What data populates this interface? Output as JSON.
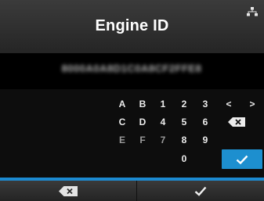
{
  "header": {
    "title": "Engine ID",
    "status_icon": "network-icon"
  },
  "value": {
    "display": "8000A0A8D1C0A8CF2FFE8"
  },
  "keypad": {
    "rows": [
      [
        "A",
        "B",
        "1",
        "2",
        "3",
        "<",
        ">"
      ],
      [
        "C",
        "D",
        "4",
        "5",
        "6"
      ],
      [
        "E",
        "F",
        "7",
        "8",
        "9"
      ],
      [
        "0"
      ]
    ],
    "backspace_icon": "backspace-icon",
    "enter_icon": "checkmark-icon"
  },
  "footer": {
    "left_icon": "backspace-icon",
    "right_icon": "checkmark-icon"
  },
  "colors": {
    "accent": "#1d8fcf",
    "background": "#0b0b0b",
    "header": "#303030"
  }
}
